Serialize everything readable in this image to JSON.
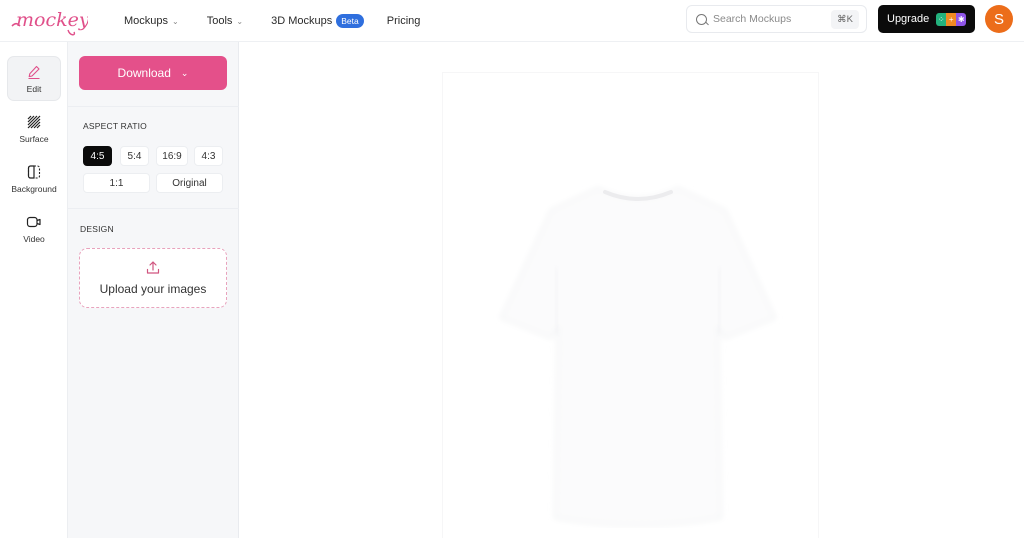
{
  "app": {
    "brand": "mockey",
    "brand_color": "#e0508a"
  },
  "nav": {
    "items": [
      {
        "label": "Mockups",
        "has_dropdown": true
      },
      {
        "label": "Tools",
        "has_dropdown": true
      },
      {
        "label": "3D Mockups",
        "badge": "Beta"
      },
      {
        "label": "Pricing"
      }
    ]
  },
  "search": {
    "placeholder": "Search Mockups",
    "value": "",
    "shortcut": "⌘K"
  },
  "upgrade": {
    "label": "Upgrade"
  },
  "user": {
    "avatar_initial": "S",
    "avatar_color": "#ec6d1a"
  },
  "rail": {
    "items": [
      {
        "label": "Edit",
        "icon": "pencil-icon",
        "active": true
      },
      {
        "label": "Surface",
        "icon": "texture-icon"
      },
      {
        "label": "Background",
        "icon": "background-icon"
      },
      {
        "label": "Video",
        "icon": "video-icon"
      }
    ]
  },
  "panel": {
    "download_label": "Download",
    "aspect_ratio": {
      "title": "ASPECT RATIO",
      "options": [
        "4:5",
        "5:4",
        "16:9",
        "4:3",
        "1:1",
        "Original"
      ],
      "selected": "4:5"
    },
    "design": {
      "title": "DESIGN",
      "upload_label": "Upload your images"
    }
  },
  "canvas": {
    "mockup": "white t-shirt"
  }
}
